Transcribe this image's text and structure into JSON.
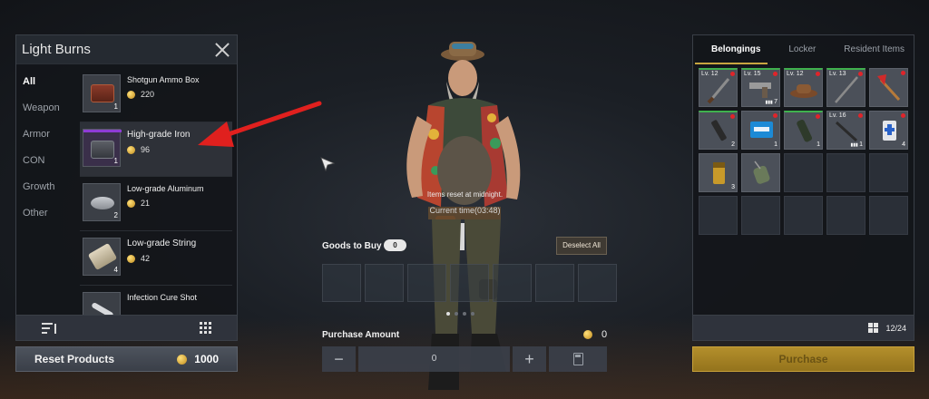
{
  "shop": {
    "title": "Light Burns",
    "categories": [
      "All",
      "Weapon",
      "Armor",
      "CON",
      "Growth",
      "Other"
    ],
    "items": [
      {
        "name": "Shotgun Ammo Box",
        "price": "220",
        "qty": "1",
        "icon": "ammo-box-icon"
      },
      {
        "name": "High-grade Iron",
        "price": "96",
        "qty": "1",
        "icon": "iron-bar-icon"
      },
      {
        "name": "Low-grade Aluminum",
        "price": "21",
        "qty": "2",
        "icon": "aluminum-icon"
      },
      {
        "name": "Low-grade String",
        "price": "42",
        "qty": "4",
        "icon": "string-icon"
      },
      {
        "name": "Infection Cure Shot",
        "price": "",
        "qty": "",
        "icon": "syringe-icon"
      }
    ],
    "reset_label": "Reset Products",
    "reset_cost": "1000"
  },
  "center": {
    "reset_note": "Items reset at midnight.",
    "current_time": "Current time(03:48)",
    "goods_label": "Goods to Buy",
    "goods_count": "0",
    "deselect_label": "Deselect All",
    "purchase_amount_label": "Purchase Amount",
    "purchase_total": "0",
    "amount_value": "0",
    "minus": "−",
    "plus": "+"
  },
  "inventory": {
    "tabs": [
      "Belongings",
      "Locker",
      "Resident Items"
    ],
    "slots": [
      {
        "lv": "Lv. 12",
        "dot": true,
        "green": true,
        "count": "",
        "ammo": "",
        "icon": "machete-icon"
      },
      {
        "lv": "Lv. 15",
        "dot": true,
        "green": true,
        "count": "7",
        "ammo": "ammo",
        "icon": "pistol-icon"
      },
      {
        "lv": "Lv. 12",
        "dot": true,
        "green": true,
        "count": "",
        "ammo": "",
        "icon": "cowboy-hat-icon"
      },
      {
        "lv": "Lv. 13",
        "dot": true,
        "green": true,
        "count": "",
        "ammo": "",
        "icon": "spear-icon"
      },
      {
        "lv": "",
        "dot": true,
        "green": false,
        "count": "",
        "ammo": "",
        "icon": "fire-axe-icon"
      },
      {
        "lv": "",
        "dot": true,
        "green": true,
        "count": "2",
        "ammo": "",
        "icon": "flashlight-icon"
      },
      {
        "lv": "",
        "dot": true,
        "green": false,
        "count": "1",
        "ammo": "",
        "icon": "first-aid-box-icon"
      },
      {
        "lv": "",
        "dot": true,
        "green": true,
        "count": "1",
        "ammo": "",
        "icon": "bandage-roll-icon"
      },
      {
        "lv": "Lv. 16",
        "dot": true,
        "green": false,
        "count": "1",
        "ammo": "ammo",
        "icon": "rifle-icon"
      },
      {
        "lv": "",
        "dot": true,
        "green": false,
        "count": "4",
        "ammo": "",
        "icon": "medicine-bottle-icon"
      },
      {
        "lv": "",
        "dot": false,
        "green": false,
        "count": "3",
        "ammo": "",
        "icon": "battery-icon"
      },
      {
        "lv": "",
        "dot": false,
        "green": false,
        "count": "",
        "ammo": "",
        "icon": "dog-tag-icon"
      }
    ],
    "capacity": "12/24",
    "purchase_label": "Purchase"
  }
}
